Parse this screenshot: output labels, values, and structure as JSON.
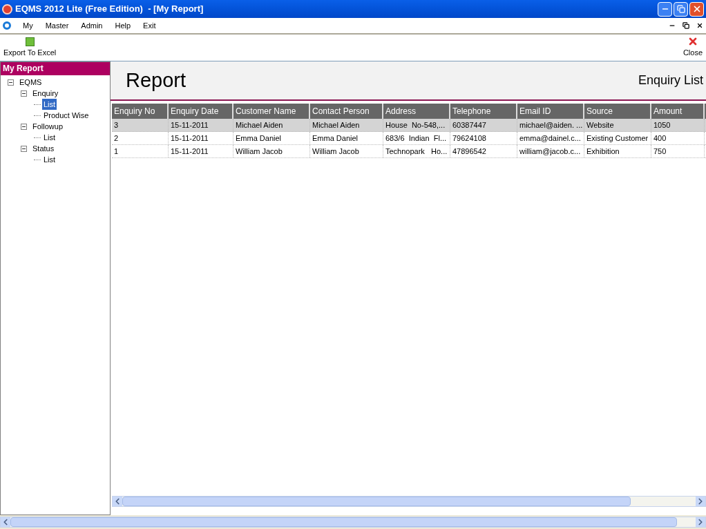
{
  "window": {
    "title": "EQMS 2012 Lite (Free Edition)  - [My Report]"
  },
  "menu": [
    "My",
    "Master",
    "Admin",
    "Help",
    "Exit"
  ],
  "toolbar": {
    "export": "Export To Excel",
    "close": "Close"
  },
  "sidebar": {
    "title": "My Report",
    "tree": [
      {
        "label": "EQMS",
        "expanded": true,
        "selected": false,
        "children": [
          {
            "label": "Enquiry",
            "expanded": true,
            "selected": false,
            "children": [
              {
                "label": "List",
                "selected": true
              },
              {
                "label": "Product Wise",
                "selected": false
              }
            ]
          },
          {
            "label": "Followup",
            "expanded": true,
            "selected": false,
            "children": [
              {
                "label": "List",
                "selected": false
              }
            ]
          },
          {
            "label": "Status",
            "expanded": true,
            "selected": false,
            "children": [
              {
                "label": "List",
                "selected": false
              }
            ]
          }
        ]
      }
    ]
  },
  "report": {
    "heading": "Report",
    "subtitle": "Enquiry List"
  },
  "table": {
    "columns": [
      "Enquiry No",
      "Enquiry Date",
      "Customer Name",
      "Contact Person",
      "Address",
      "Telephone",
      "Email ID",
      "Source",
      "Amount"
    ],
    "rows": [
      {
        "selected": true,
        "cells": [
          "3",
          "15-11-2011",
          "Michael Aiden",
          "Michael Aiden",
          "House  No-548,...",
          "60387447",
          "michael@aiden. ...",
          "Website",
          "1050"
        ]
      },
      {
        "selected": false,
        "cells": [
          "2",
          "15-11-2011",
          "Emma Daniel",
          "Emma Daniel",
          "683/6  Indian  Fl...",
          "79624108",
          "emma@dainel.c...",
          "Existing Customer",
          "400"
        ]
      },
      {
        "selected": false,
        "cells": [
          "1",
          "15-11-2011",
          "William Jacob",
          "William Jacob",
          "Technopark   Ho...",
          "47896542",
          "william@jacob.c...",
          "Exhibition",
          "750"
        ]
      }
    ]
  }
}
